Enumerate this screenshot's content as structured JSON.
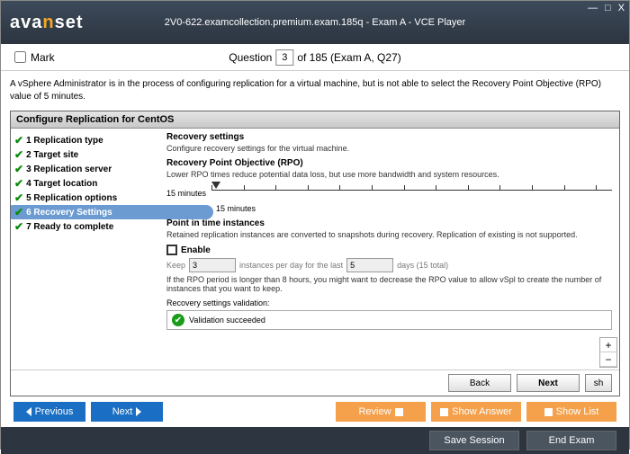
{
  "window": {
    "title": "2V0-622.examcollection.premium.exam.185q - Exam A - VCE Player",
    "logo_a": "ava",
    "logo_b": "n",
    "logo_c": "set"
  },
  "mark_label": "Mark",
  "question_label": "Question",
  "question_num": "3",
  "question_total": " of 185 (Exam A, Q27)",
  "question_body": "A vSphere Administrator is in the process of configuring replication for a virtual machine, but is not able to select the Recovery Point Objective (RPO) value of 5 minutes.",
  "panel_title": "Configure Replication for CentOS",
  "steps": [
    "1 Replication type",
    "2 Target site",
    "3 Replication server",
    "4 Target location",
    "5 Replication options",
    "6 Recovery Settings",
    "7 Ready to complete"
  ],
  "content": {
    "h1": "Recovery settings",
    "p1": "Configure recovery settings for the virtual machine.",
    "h2": "Recovery Point Objective (RPO)",
    "p2": "Lower RPO times reduce potential data loss, but use more bandwidth and system resources.",
    "slider_min": "15 minutes",
    "slider_val": "15 minutes",
    "h3": "Point in time instances",
    "p3": "Retained replication instances are converted to snapshots during recovery. Replication of existing is not supported.",
    "enable": "Enable",
    "keep": "Keep",
    "inst_val": "3",
    "inst_mid": "instances per day for the last",
    "days_val": "5",
    "days_end": "days (15 total)",
    "p4": "If the RPO period is longer than 8 hours, you might want to decrease the RPO value to allow vSpl to create the number of instances that you want to keep.",
    "val_label": "Recovery settings validation:",
    "val_msg": "Validation succeeded"
  },
  "panel_buttons": {
    "back": "Back",
    "next": "Next",
    "sh": "sh"
  },
  "nav": {
    "prev": "Previous",
    "next": "Next",
    "review": "Review",
    "show_answer": "Show Answer",
    "show_list": "Show List"
  },
  "footer": {
    "save": "Save Session",
    "end": "End Exam"
  }
}
